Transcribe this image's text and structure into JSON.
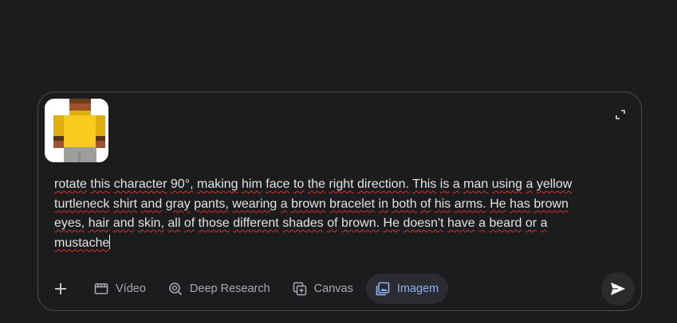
{
  "composer": {
    "attachment": {
      "kind": "pixel-art-character-thumbnail",
      "colors": {
        "skin": "#a0522d",
        "hair": "#6e3b1e",
        "shirt": "#f5c518",
        "shirt_shade": "#e0ae0c",
        "pants": "#9e9e9e",
        "bracelet": "#5a3418"
      }
    },
    "expand_icon": "expand-icon",
    "prompt_lines": [
      [
        "rotate",
        "this",
        "character",
        "90°,",
        "making",
        "him",
        "face",
        "to",
        "the",
        "right",
        "direction.",
        "This",
        "is",
        "a",
        "man",
        "using",
        "a",
        "yellow"
      ],
      [
        "turtleneck",
        "shirt",
        "and",
        "gray",
        "pants,",
        "wearing",
        "a",
        "brown",
        "bracelet",
        "in",
        "both",
        "of",
        "his",
        "arms.",
        "He",
        "has",
        "brown"
      ],
      [
        "eyes,",
        "hair",
        "and",
        "skin,",
        "all",
        "of",
        "those",
        "different",
        "shades",
        "of",
        "brown.",
        "He",
        "doesn't",
        "have",
        "a",
        "beard",
        "or",
        "a"
      ],
      [
        "mustache"
      ]
    ]
  },
  "toolbar": {
    "add_icon": "plus-icon",
    "tools": [
      {
        "label": "Vídeo",
        "icon": "video-icon",
        "active": false
      },
      {
        "label": "Deep Research",
        "icon": "deep-research-icon",
        "active": false
      },
      {
        "label": "Canvas",
        "icon": "canvas-icon",
        "active": false
      },
      {
        "label": "Imagem",
        "icon": "image-icon",
        "active": true
      }
    ],
    "send_icon": "send-icon"
  },
  "colors": {
    "background": "#1b1c1d",
    "border": "#4a4b4d",
    "text": "#e3e3e3",
    "muted": "#a8abb0",
    "accent": "#8ab4f8",
    "spellcheck": "#d93025"
  }
}
